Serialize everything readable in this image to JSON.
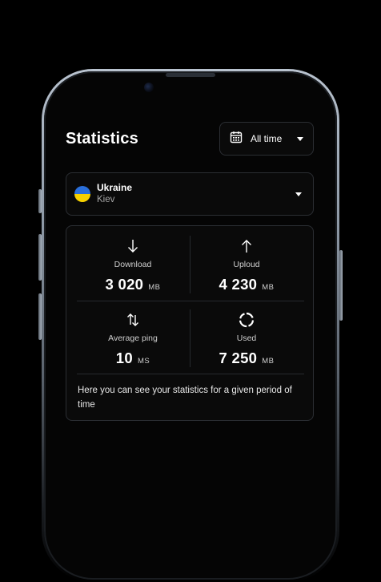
{
  "header": {
    "title": "Statistics",
    "period": {
      "selected": "All time",
      "icon": "calendar-icon"
    }
  },
  "location": {
    "country": "Ukraine",
    "city": "Kiev",
    "flag_colors": [
      "#2a6fdb",
      "#f7d100"
    ]
  },
  "stats": [
    {
      "icon": "arrow-down-icon",
      "label": "Download",
      "value": "3 020",
      "unit": "MB"
    },
    {
      "icon": "arrow-up-icon",
      "label": "Uploud",
      "value": "4 230",
      "unit": "MB"
    },
    {
      "icon": "swap-arrows-icon",
      "label": "Average ping",
      "value": "10",
      "unit": "MS"
    },
    {
      "icon": "circular-progress-icon",
      "label": "Used",
      "value": "7 250",
      "unit": "MB"
    }
  ],
  "note": "Here you can see your statistics for a given period of time"
}
